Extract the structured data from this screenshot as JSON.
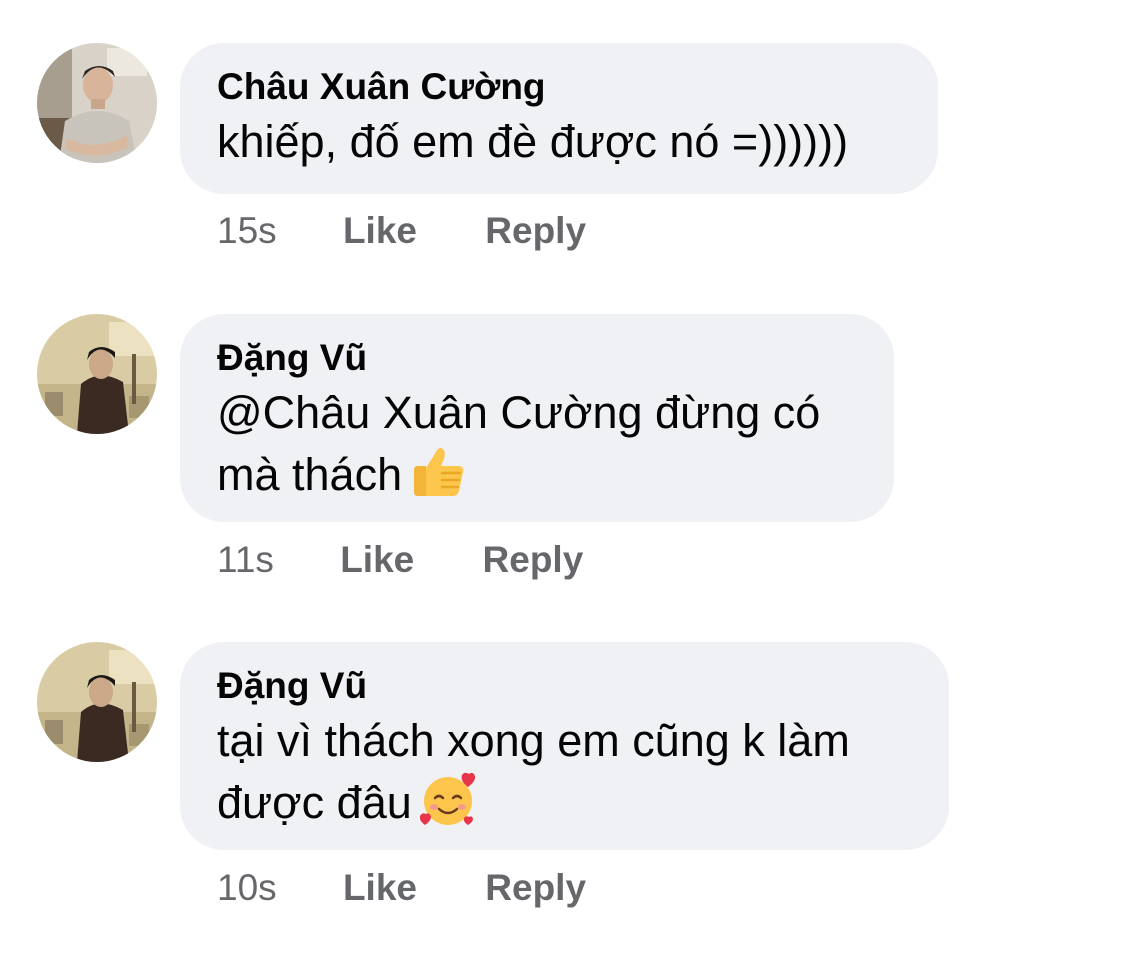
{
  "comments": [
    {
      "author": "Châu Xuân Cường",
      "lines": [
        "khiếp, đố em đè được nó =))))))"
      ],
      "emoji": null,
      "time": "15s",
      "like_label": "Like",
      "reply_label": "Reply"
    },
    {
      "author": "Đặng Vũ",
      "lines": [
        "@Châu Xuân Cường đừng có",
        "mà thách"
      ],
      "emoji": "thumbs-up-icon",
      "time": "11s",
      "like_label": "Like",
      "reply_label": "Reply"
    },
    {
      "author": "Đặng Vũ",
      "lines": [
        "tại vì thách xong em cũng k làm",
        "được đâu"
      ],
      "emoji": "smiling-face-with-hearts-icon",
      "time": "10s",
      "like_label": "Like",
      "reply_label": "Reply"
    }
  ],
  "colors": {
    "bubble": "#f0f1f5",
    "text": "#050505",
    "meta": "#65676b"
  }
}
